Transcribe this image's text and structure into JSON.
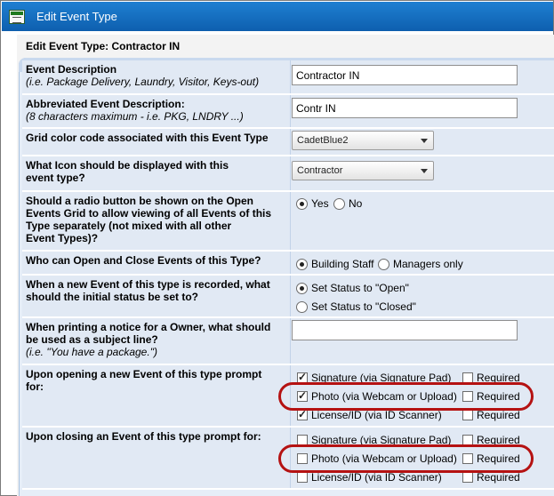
{
  "window": {
    "title": "Edit Event Type",
    "app_icon": "form-icon"
  },
  "panel": {
    "header": "Edit Event Type: Contractor IN"
  },
  "fields": {
    "description": {
      "label": "Event Description",
      "hint": "(i.e. Package Delivery, Laundry, Visitor, Keys-out)",
      "value": "Contractor IN"
    },
    "abbrev": {
      "label": "Abbreviated Event Description:",
      "hint": "(8 characters maximum - i.e. PKG, LNDRY ...)",
      "value": "Contr IN"
    },
    "color": {
      "label": "Grid color code associated with this Event Type",
      "value": "CadetBlue2"
    },
    "icon": {
      "label_line1": "What Icon should be displayed with this",
      "label_line2": "event type?",
      "value": "Contractor"
    },
    "radio_grid": {
      "label_lines": [
        "Should a radio button be shown on the Open",
        "Events Grid to allow viewing of all Events of this",
        "Type separately (not mixed with all other",
        "Event Types)?"
      ],
      "options": [
        "Yes",
        "No"
      ],
      "selected": "Yes"
    },
    "who_open": {
      "label": "Who can Open and Close Events of this Type?",
      "options": [
        "Building Staff",
        "Managers only"
      ],
      "selected": "Building Staff"
    },
    "initial_status": {
      "label_line1": "When a new Event of this type is recorded, what",
      "label_line2": "should the initial status be set to?",
      "options": [
        "Set Status to \"Open\"",
        "Set Status to \"Closed\""
      ],
      "selected": "Set Status to \"Open\""
    },
    "subject": {
      "label_line1": "When printing a notice for a Owner, what should",
      "label_line2": "be used as a subject line?",
      "hint": "(i.e. \"You have a package.\")",
      "value": ""
    },
    "open_prompt": {
      "label": "Upon opening a new Event of this type prompt for:",
      "items": [
        {
          "label": "Signature (via Signature Pad)",
          "checked": true,
          "required_label": "Required",
          "required": false
        },
        {
          "label": "Photo (via Webcam or Upload)",
          "checked": true,
          "required_label": "Required",
          "required": false
        },
        {
          "label": "License/ID (via ID Scanner)",
          "checked": true,
          "required_label": "Required",
          "required": false
        }
      ]
    },
    "close_prompt": {
      "label": "Upon closing an Event of this type prompt for:",
      "items": [
        {
          "label": "Signature (via Signature Pad)",
          "checked": false,
          "required_label": "Required",
          "required": false
        },
        {
          "label": "Photo (via Webcam or Upload)",
          "checked": false,
          "required_label": "Required",
          "required": false
        },
        {
          "label": "License/ID (via ID Scanner)",
          "checked": false,
          "required_label": "Required",
          "required": false
        }
      ]
    }
  },
  "colors": {
    "titlebar": "#1570c4",
    "highlight": "#b51212",
    "row_bg": "#e1e9f4"
  }
}
